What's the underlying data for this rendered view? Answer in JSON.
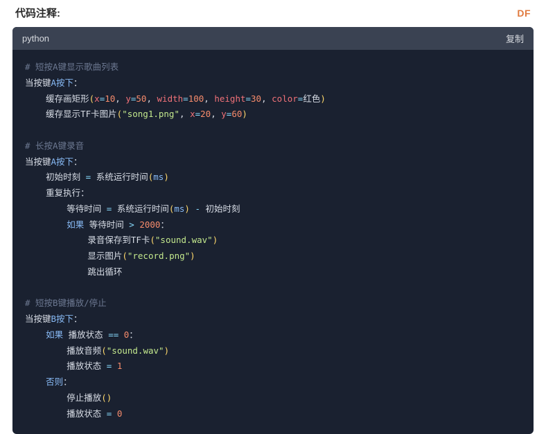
{
  "header": {
    "title": "代码注释:",
    "badge": "DF"
  },
  "codecard": {
    "lang": "python",
    "copy": "复制"
  },
  "code": {
    "c1": "# 短按A键显示歌曲列表",
    "l2a": "当按键",
    "l2b": "A按下",
    "l2c": "：",
    "l3a": "缓存画矩形",
    "l3_x": "x",
    "l3_eq": "=",
    "l3_10": "10",
    "l3_y": "y",
    "l3_50": "50",
    "l3_w": "width",
    "l3_100": "100",
    "l3_h": "height",
    "l3_30": "30",
    "l3_col": "color",
    "l3_red": "红色",
    "l4a": "缓存显示TF卡图片",
    "l4_s": "\"song1.png\"",
    "l4_x": "x",
    "l4_20": "20",
    "l4_y": "y",
    "l4_60": "60",
    "c2": "# 长按A键录音",
    "l6a": "当按键",
    "l6b": "A按下",
    "l6c": "：",
    "l7a": "初始时刻",
    "l7eq": " = ",
    "l7b": "系统运行时间",
    "l7ms": "ms",
    "l8a": "重复执行",
    "l8c": "：",
    "l9a": "等待时间",
    "l9eq": " = ",
    "l9b": "系统运行时间",
    "l9ms": "ms",
    "l9minus": " - ",
    "l9c": "初始时刻",
    "l10a": "如果",
    "l10sp": " ",
    "l10b": "等待时间",
    "l10gt": " > ",
    "l10n": "2000",
    "l10c": "：",
    "l11a": "录音保存到TF卡",
    "l11s": "\"sound.wav\"",
    "l12a": "显示图片",
    "l12s": "\"record.png\"",
    "l13a": "跳出循环",
    "c3": "# 短按B键播放/停止",
    "l15a": "当按键",
    "l15b": "B按下",
    "l15c": "：",
    "l16a": "如果",
    "l16b": " 播放状态 ",
    "l16eq": "==",
    "l16sp": " ",
    "l16n": "0",
    "l16c": "：",
    "l17a": "播放音频",
    "l17s": "\"sound.wav\"",
    "l18a": "播放状态",
    "l18eq": " = ",
    "l18n": "1",
    "l19a": "否则",
    "l19c": "：",
    "l20a": "停止播放",
    "l21a": "播放状态",
    "l21eq": " = ",
    "l21n": "0",
    "comma": ", "
  }
}
